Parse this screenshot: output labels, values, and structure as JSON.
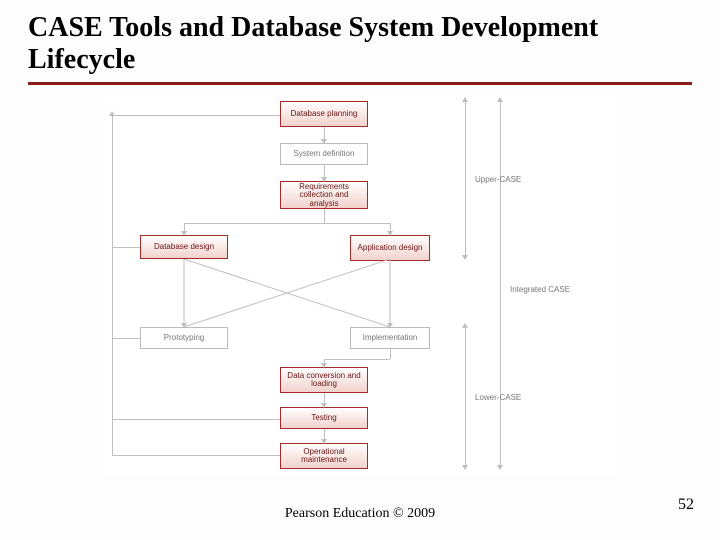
{
  "title": "CASE Tools and Database System Development Lifecycle",
  "boxes": {
    "db_planning": "Database planning",
    "system_def": "System definition",
    "requirements": "Requirements collection and analysis",
    "db_design": "Database design",
    "app_design": "Application design",
    "prototyping": "Prototyping",
    "implementation": "Implementation",
    "data_conv": "Data conversion and loading",
    "testing": "Testing",
    "op_maint": "Operational maintenance"
  },
  "labels": {
    "upper": "Upper-CASE",
    "lower": "Lower-CASE",
    "integrated": "Integrated CASE"
  },
  "footer": "Pearson Education © 2009",
  "page": "52"
}
